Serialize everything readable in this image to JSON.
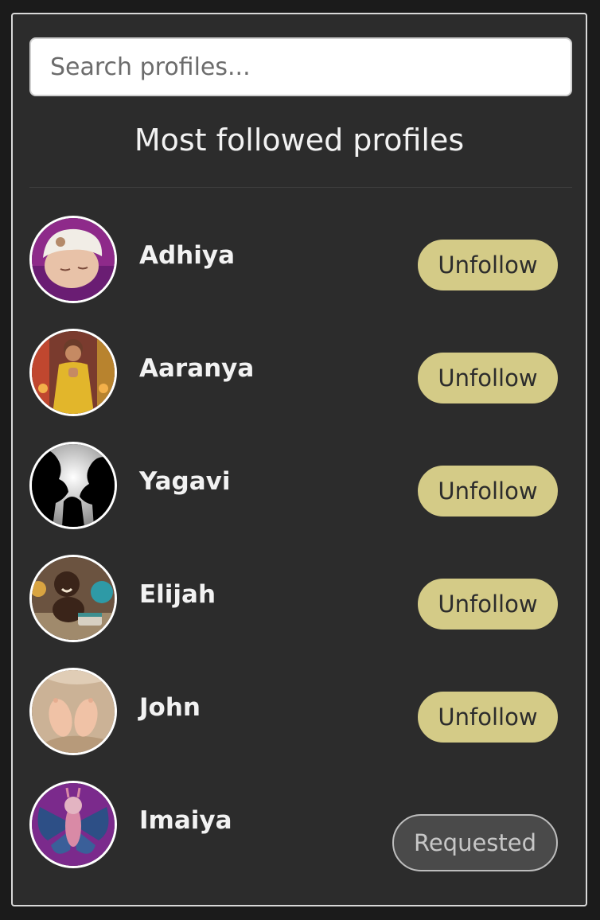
{
  "search": {
    "placeholder": "Search profiles..."
  },
  "heading": "Most followed profiles",
  "profiles": [
    {
      "name": "Adhiya",
      "action": "Unfollow",
      "avatar_icon": "sleeping-baby-avatar"
    },
    {
      "name": "Aaranya",
      "action": "Unfollow",
      "avatar_icon": "girl-yellow-dress-avatar"
    },
    {
      "name": "Yagavi",
      "action": "Unfollow",
      "avatar_icon": "silhouette-family-avatar"
    },
    {
      "name": "Elijah",
      "action": "Unfollow",
      "avatar_icon": "laughing-baby-avatar"
    },
    {
      "name": "John",
      "action": "Unfollow",
      "avatar_icon": "baby-feet-avatar"
    },
    {
      "name": "Imaiya",
      "action": "Requested",
      "avatar_icon": "butterfly-costume-avatar"
    }
  ],
  "colors": {
    "panel_bg": "#2c2c2c",
    "unfollow_bg": "#d4cb87",
    "requested_bg": "#4a4a4a",
    "text": "#f2f2f2"
  }
}
